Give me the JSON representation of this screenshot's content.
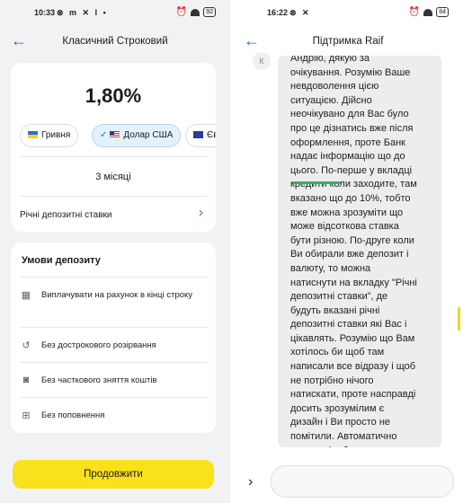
{
  "left_screen": {
    "status": {
      "time": "10:33",
      "icons": "⊗ m ✕ l •",
      "battery": "92"
    },
    "header": {
      "back_icon": "arrow-left-icon",
      "title": "Класичний Строковий"
    },
    "rate_card": {
      "rate": "1,80%",
      "currencies": [
        {
          "label": "Гривня",
          "selected": false
        },
        {
          "label": "Долар США",
          "selected": true
        },
        {
          "label": "Євр",
          "selected": false
        }
      ],
      "term": "3 місяці",
      "annual_rates_label": "Річні депозитні ставки"
    },
    "conditions": {
      "title": "Умови депозиту",
      "items": [
        {
          "icon": "calendar-icon",
          "text": "Виплачувати на рахунок в кінці строку"
        },
        {
          "icon": "history-icon",
          "text": "Без дострокового розірвання"
        },
        {
          "icon": "cash-icon",
          "text": "Без часткового зняття коштів"
        },
        {
          "icon": "add-card-icon",
          "text": "Без поповнення"
        }
      ]
    },
    "continue_label": "Продовжити"
  },
  "right_screen": {
    "status": {
      "time": "16:22",
      "icons": "⊗ ✕",
      "battery": "84"
    },
    "header": {
      "back_icon": "arrow-left-icon",
      "title": "Підтримка Raif"
    },
    "avatar_letter": "К",
    "message": "Андрію, дякую за\nочікування. Розумію Ваше\nневдоволення цією\nситуацією. Дійсно\nнеочікувано для Вас було\nпро це дізнатись вже після\nоформлення, проте Банк\nнадає інформацію що до\nцього. По-перше у вкладці\nкредити коли заходите, там\nвказано що до 10%, тобто\nвже можна зрозуміти що\nможе відсоткова ставка\nбути різною. По-друге коли\nВи обирали вже депозит і\nвалюту, то можна\nнатиснути на вкладку \"Річні\nдепозитні ставки\", де\nбудуть вказані річні\nдепозитні ставки які Вас і\nцікавлять. Розумію що Вам\nхотілось би щоб там\nнаписали все відразу і щоб\nне потрібно нічого\nнатискати, проте насправді\nдосить зрозумілим є\nдизайн і Ви просто не\nпомітили. Автоматично\nзверху відображається\nмаксимальна відсоткова\nставка яка може бути, адже\nпотрібно якусь"
  },
  "colors": {
    "accent": "#1d6fd1",
    "cta": "#f9e21b",
    "underline": "#2fb45a"
  }
}
